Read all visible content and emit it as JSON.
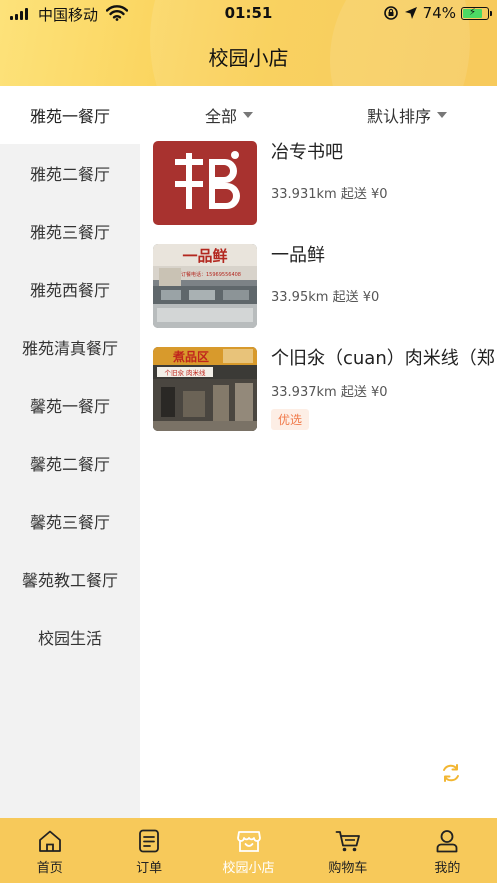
{
  "status_bar": {
    "carrier": "中国移动",
    "time": "01:51",
    "battery_percent": "74%"
  },
  "header": {
    "title": "校园小店"
  },
  "sidebar": {
    "items": [
      {
        "label": "雅苑一餐厅",
        "active": true
      },
      {
        "label": "雅苑二餐厅"
      },
      {
        "label": "雅苑三餐厅"
      },
      {
        "label": "雅苑西餐厅"
      },
      {
        "label": "雅苑清真餐厅"
      },
      {
        "label": "馨苑一餐厅"
      },
      {
        "label": "馨苑二餐厅"
      },
      {
        "label": "馨苑三餐厅"
      },
      {
        "label": "馨苑教工餐厅"
      },
      {
        "label": "校园生活"
      }
    ]
  },
  "filters": {
    "category": "全部",
    "sort": "默认排序"
  },
  "shops": [
    {
      "name": "冶专书吧",
      "distance": "33.931km",
      "min_order": "起送 ¥0",
      "thumb_text": "书"
    },
    {
      "name": "一品鲜",
      "distance": "33.95km",
      "min_order": "起送 ¥0",
      "thumb_text": "一品鲜",
      "thumb_subtext": "订餐电话：15969556408"
    },
    {
      "name": "个旧氽（cuan）肉米线（郑",
      "distance": "33.937km",
      "min_order": "起送 ¥0",
      "tag": "优选",
      "thumb_text": "煮品区",
      "thumb_subtext": "个旧氽 肉米线"
    }
  ],
  "tabbar": {
    "items": [
      {
        "label": "首页",
        "icon": "home-icon"
      },
      {
        "label": "订单",
        "icon": "order-icon"
      },
      {
        "label": "校园小店",
        "icon": "shop-icon",
        "active": true
      },
      {
        "label": "购物车",
        "icon": "cart-icon"
      },
      {
        "label": "我的",
        "icon": "user-icon"
      }
    ]
  },
  "colors": {
    "header_gradient_start": "#fde27a",
    "header_gradient_end": "#f6c44a",
    "tabbar_bg": "#f7c95a",
    "sidebar_bg": "#f2f2f2",
    "tag_text": "#f07a4a",
    "tag_bg": "#fdeee5",
    "book_logo_bg": "#a8322f"
  }
}
